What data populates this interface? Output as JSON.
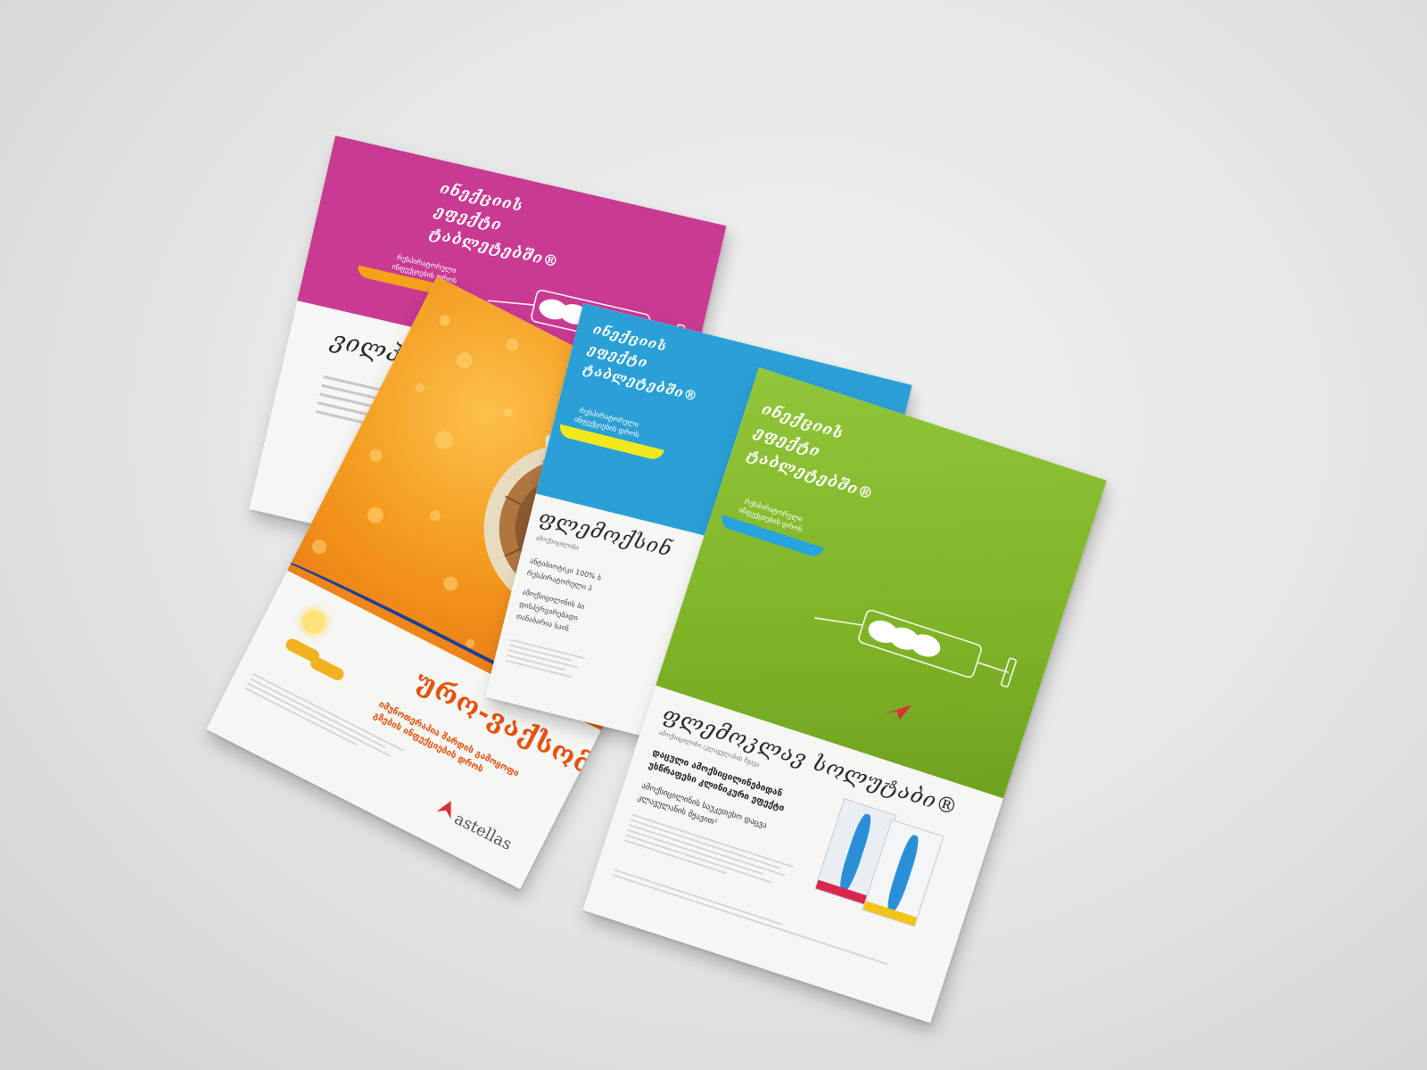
{
  "palette": {
    "magenta": "#c93a93",
    "blue": "#2aa0d6",
    "green": "#82b82a",
    "orange": "#f29a1e",
    "brand_red": "#d92f3a",
    "paper": "#f6f6f4"
  },
  "flyer_pink": {
    "headline": [
      "ინექციის",
      "ეფექტი",
      "ტაბლეტებში®"
    ],
    "subline": [
      "რესპირატორული",
      "ინფექციების დროს"
    ],
    "title": "ვილპრაფე"
  },
  "flyer_orange": {
    "title": "ურო-ვაქსომ",
    "tagline": [
      "იმუნოთერაპია შარდის გამოყოფი",
      "გზების ინფექციების დროს"
    ],
    "brand": "astellas"
  },
  "flyer_blue": {
    "headline": [
      "ინექციის",
      "ეფექტი",
      "ტაბლეტებში®"
    ],
    "subline": [
      "რესპირატორული",
      "ინფექციების დროს"
    ],
    "title": "ფლემოქსინ",
    "caption": "ამოქსიცილინი",
    "body": [
      "ანტიბიოტიკი 100% ბ",
      "რესპირატორული პ",
      "ამოქსიცილინის ბი",
      "დისპერგირებადი",
      "თანაბარია საინ"
    ]
  },
  "flyer_green": {
    "headline": [
      "ინექციის",
      "ეფექტი",
      "ტაბლეტებში®"
    ],
    "subline": [
      "რესპირატორული",
      "ინფექციების დროს"
    ],
    "title": "ფლემოკლავ სოლუტაბი®",
    "caption": "ამოქსიცილინი /კლავულანის მჟავა",
    "claim": [
      "დაცული ამოქსიცილინებიდან",
      "უსწრაფესი კლინიკური ეფექტი"
    ],
    "note": [
      "ამოქსიცილინის საუკეთესო დაცვა",
      "კლავულანის მჟავით¹"
    ]
  }
}
